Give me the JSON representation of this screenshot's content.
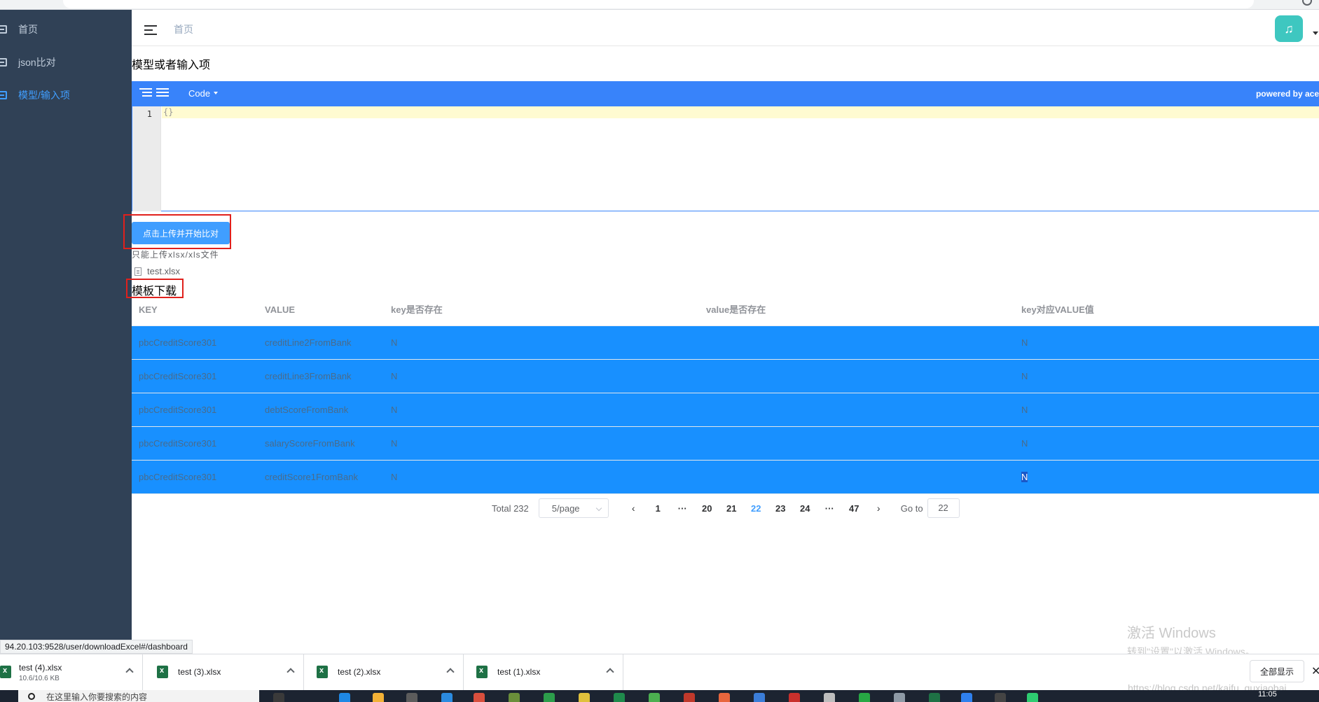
{
  "browser": {
    "status_url": "94.20.103:9528/user/downloadExcel#/dashboard"
  },
  "sidebar": {
    "items": [
      {
        "label": "首页",
        "icon": "dashboard-icon",
        "active": false
      },
      {
        "label": "json比对",
        "icon": "dashboard-icon",
        "active": false
      },
      {
        "label": "模型/输入项",
        "icon": "dashboard-icon",
        "active": true
      }
    ]
  },
  "navbar": {
    "breadcrumb": "首页",
    "avatar_icon": "guitar-icon",
    "avatar_color": "#3ec7c0"
  },
  "main": {
    "section_title": "模型或者输入项",
    "editor": {
      "mode_label": "Code",
      "powered_by": "powered by ace",
      "line_number": "1",
      "content": "{}",
      "menu_color": "#3883fa"
    },
    "upload": {
      "button_label": "点击上传并开始比对",
      "tip": "只能上传xlsx/xls文件",
      "file_name": "test.xlsx"
    },
    "download_label": "模板下载",
    "table": {
      "headers": [
        "KEY",
        "VALUE",
        "key是否存在",
        "value是否存在",
        "key对应VALUE值"
      ],
      "rows": [
        [
          "pbcCreditScore301",
          "creditLine2FromBank",
          "N",
          "",
          "N"
        ],
        [
          "pbcCreditScore301",
          "creditLine3FromBank",
          "N",
          "",
          "N"
        ],
        [
          "pbcCreditScore301",
          "debtScoreFromBank",
          "N",
          "",
          "N"
        ],
        [
          "pbcCreditScore301",
          "salaryScoreFromBank",
          "N",
          "",
          "N"
        ],
        [
          "pbcCreditScore301",
          "creditScore1FromBank",
          "N",
          "",
          "N"
        ]
      ],
      "row_color": "#1890ff"
    },
    "pagination": {
      "total": "Total 232",
      "page_size": "5/page",
      "pages": [
        "1",
        "···",
        "20",
        "21",
        "22",
        "23",
        "24",
        "···",
        "47"
      ],
      "current": "22",
      "goto_label": "Go to",
      "goto_value": "22"
    }
  },
  "watermark": {
    "line1": "激活 Windows",
    "line2": "转到\"设置\"以激活 Windows。"
  },
  "downloads": {
    "items": [
      {
        "name": "test (4).xlsx",
        "size": "10.6/10.6 KB"
      },
      {
        "name": "test (3).xlsx",
        "size": ""
      },
      {
        "name": "test (2).xlsx",
        "size": ""
      },
      {
        "name": "test (1).xlsx",
        "size": ""
      }
    ],
    "show_all": "全部显示",
    "blog_url": "https://blog.csdn.net/kaifu_guxiaobai"
  },
  "taskbar": {
    "search_placeholder": "在这里输入你要搜索的内容",
    "time": "11:05"
  }
}
